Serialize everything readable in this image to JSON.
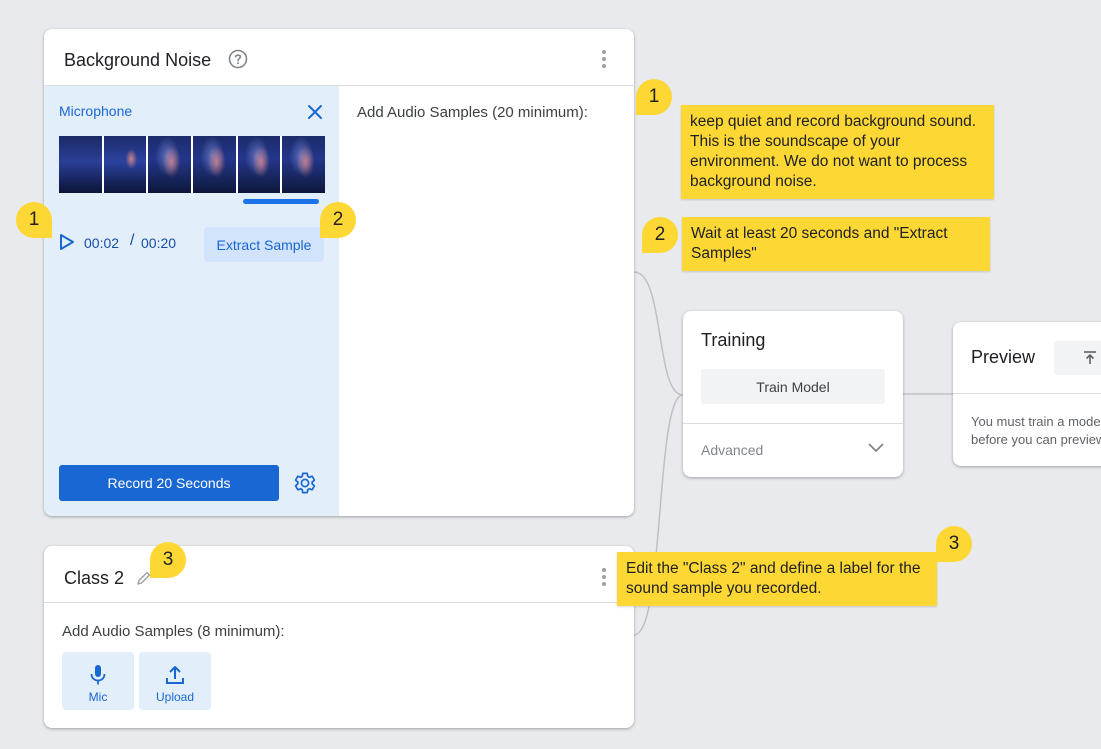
{
  "background_card": {
    "title": "Background Noise",
    "help_icon": "help-circle-icon",
    "menu_icon": "more-vert-icon",
    "mic_panel": {
      "label": "Microphone",
      "close_icon": "close-icon",
      "current_time": "00:02",
      "separator": "/",
      "total_time": "00:20",
      "extract_label": "Extract Sample",
      "record_label": "Record 20 Seconds",
      "settings_icon": "gear-icon"
    },
    "samples_label": "Add Audio Samples (20 minimum):"
  },
  "class_card": {
    "title": "Class 2",
    "edit_icon": "pencil-icon",
    "menu_icon": "more-vert-icon",
    "samples_label": "Add Audio Samples (8 minimum):",
    "mic_button": {
      "label": "Mic",
      "icon": "mic-icon"
    },
    "upload_button": {
      "label": "Upload",
      "icon": "upload-icon"
    }
  },
  "training_card": {
    "title": "Training",
    "train_label": "Train Model",
    "advanced_label": "Advanced",
    "chevron_icon": "chevron-down-icon"
  },
  "preview_card": {
    "title": "Preview",
    "export_icon": "export-icon",
    "message": "You must train a model\nbefore you can preview it here."
  },
  "callouts": [
    {
      "number": "1",
      "text": "keep quiet and record background sound. This is the soundscape of your environment. We do not want to process background noise."
    },
    {
      "number": "2",
      "text": "Wait at least 20 seconds and \"Extract Samples\""
    },
    {
      "number": "3",
      "text": "Edit the \"Class 2\" and define a label for the sound sample you recorded."
    }
  ],
  "colors": {
    "accent": "#1967d2",
    "panel_bg": "#e3eefb",
    "callout": "#fdd835",
    "canvas": "#e8eaed"
  }
}
